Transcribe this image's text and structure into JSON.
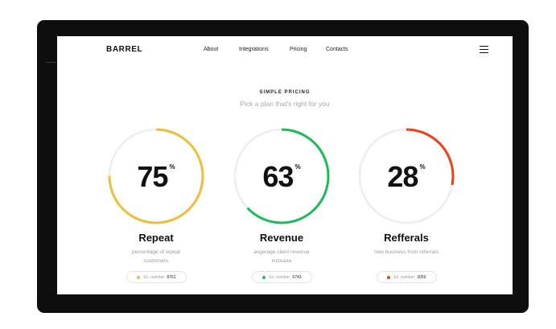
{
  "nav": {
    "logo": "BARREL",
    "links": [
      "About",
      "Integrations",
      "Pricing",
      "Contacts"
    ]
  },
  "hero": {
    "eyebrow": "SIMPLE PRICING",
    "subtitle": "Pick a plan that's right for you"
  },
  "cards": [
    {
      "value": "75",
      "unit": "%",
      "percent": 75,
      "title": "Repeat",
      "description": "percentage of repeat customers",
      "example_label": "Ex. number:",
      "example_value": "8761",
      "color": "#f0bd3b"
    },
    {
      "value": "63",
      "unit": "%",
      "percent": 63,
      "title": "Revenue",
      "description": "avgerage client revenue increase",
      "example_label": "Ex. number:",
      "example_value": "6743",
      "color": "#1dbb55"
    },
    {
      "value": "28",
      "unit": "%",
      "percent": 28,
      "title": "Refferals",
      "description": "new business from referrals",
      "example_label": "Ex. number:",
      "example_value": "3050",
      "color": "#ec4117"
    }
  ],
  "colors": {
    "track": "#efefef",
    "frame": "#0e0e0e"
  }
}
